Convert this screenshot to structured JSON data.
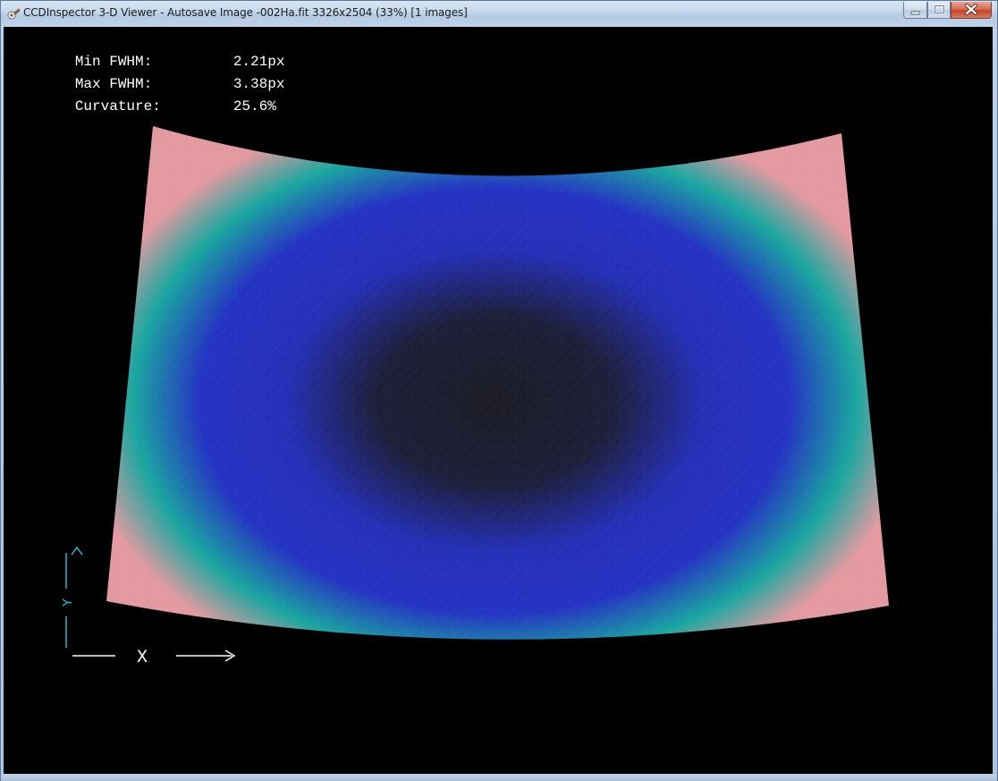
{
  "window": {
    "title": "CCDInspector 3-D Viewer - Autosave Image -002Ha.fit 3326x2504 (33%)  [1 images]"
  },
  "stats": {
    "min_fwhm_label": "Min FWHM:",
    "min_fwhm_value": "2.21px",
    "max_fwhm_label": "Max FWHM:",
    "max_fwhm_value": "3.38px",
    "curvature_label": "Curvature:",
    "curvature_value": "25.6%"
  },
  "axes": {
    "x_label": "X",
    "y_label": "Y",
    "color": "#29c6d6"
  },
  "surface_colors": {
    "center": "#1c1c26",
    "mid": "#2530b8",
    "teal": "#1aa6a0",
    "corner": "#e29aa0"
  }
}
